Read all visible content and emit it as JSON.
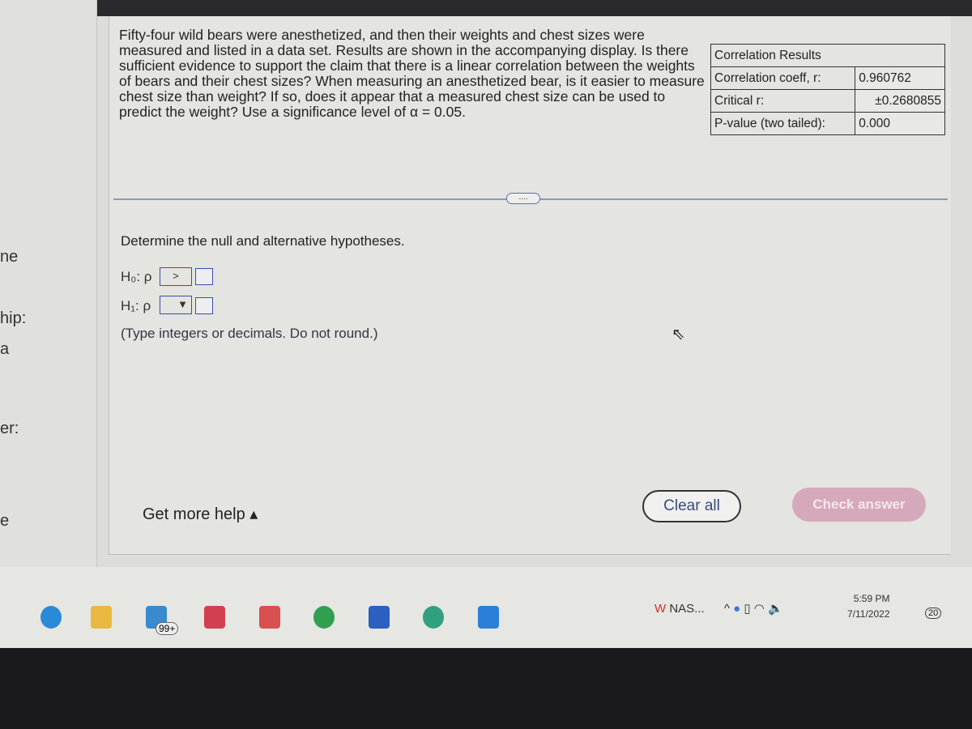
{
  "left_panel": {
    "fragments": [
      "ne",
      "hip:",
      "a",
      "er:",
      "e"
    ]
  },
  "question": {
    "text": "Fifty-four wild bears were anesthetized, and then their weights and chest sizes were measured and listed in a data set. Results are shown in the accompanying display. Is there sufficient evidence to support the claim that there is a linear correlation between the weights of bears and their chest sizes? When measuring an anesthetized bear, is it easier to measure chest size than weight? If so, does it appear that a measured chest size can be used to predict the weight? Use a significance level of α = 0.05."
  },
  "correlation": {
    "title": "Correlation Results",
    "rows": [
      {
        "label": "Correlation coeff, r:",
        "value": "0.960762"
      },
      {
        "label": "Critical r:",
        "value": "±0.2680855"
      },
      {
        "label": "P-value (two tailed):",
        "value": "0.000"
      }
    ]
  },
  "expand": "....",
  "prompt": "Determine the null and alternative hypotheses.",
  "h0": {
    "label": "H₀: ρ",
    "selected": ">",
    "value": ""
  },
  "h1": {
    "label": "H₁: ρ",
    "selected": "▼",
    "value": ""
  },
  "note": "(Type integers or decimals. Do not round.)",
  "buttons": {
    "help": "Get more help ▴",
    "clear": "Clear all",
    "check": "Check answer"
  },
  "taskbar": {
    "apps": [
      "edge-icon",
      "file-explorer-icon",
      "mail-icon",
      "reader-icon",
      "app-icon",
      "chrome-icon",
      "word-icon",
      "edge-dev-icon",
      "store-icon"
    ],
    "mail_badge": "99+",
    "tray_app": "NAS...",
    "time": "5:59 PM",
    "date": "7/11/2022",
    "notifications": "20"
  },
  "colors": {
    "accent": "#3a4eb0",
    "check_button": "#d6a8bc"
  }
}
